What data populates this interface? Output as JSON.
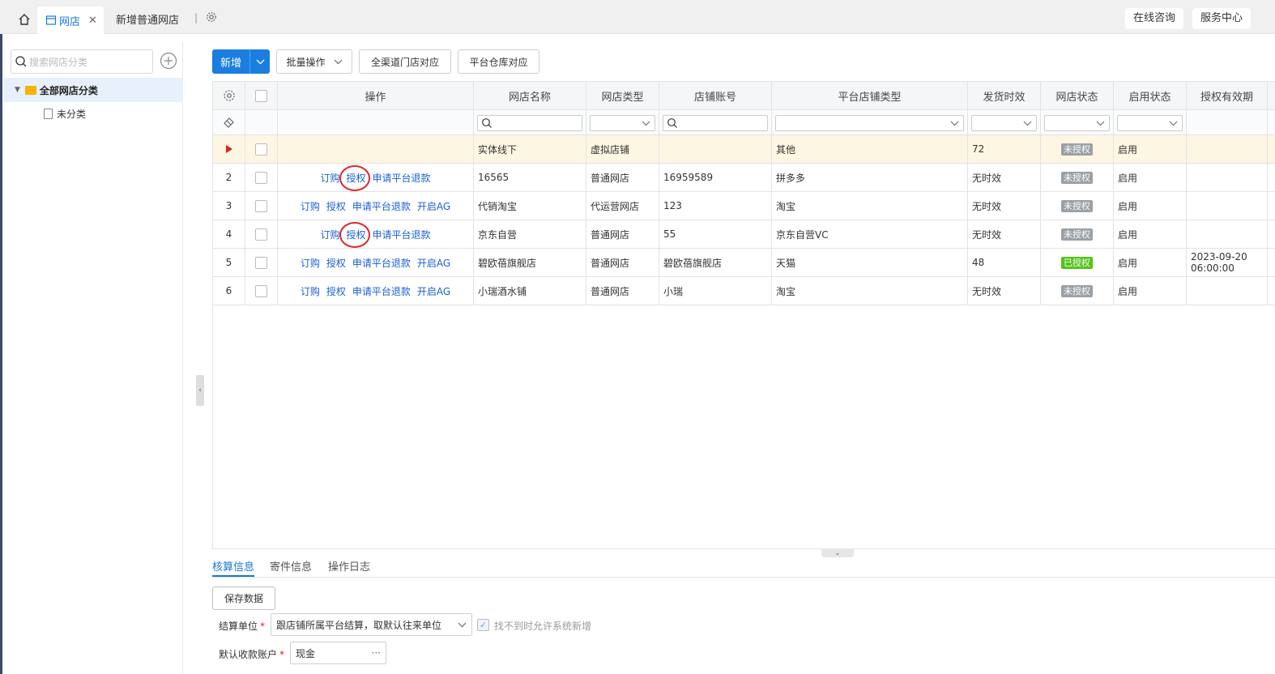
{
  "tabs": {
    "active": "网店",
    "second": "新增普通网店",
    "separator": "|"
  },
  "topbar": {
    "online_consult": "在线咨询",
    "service_center": "服务中心"
  },
  "sidebar": {
    "search_placeholder": "搜索网店分类",
    "root_label": "全部网店分类",
    "child_label": "未分类"
  },
  "toolbar": {
    "new_label": "新增",
    "batch_label": "批量操作",
    "channel_label": "全渠道门店对应",
    "warehouse_label": "平台仓库对应"
  },
  "grid": {
    "columns": [
      "操作",
      "网店名称",
      "网店类型",
      "店铺账号",
      "平台店铺类型",
      "发货时效",
      "网店状态",
      "启用状态",
      "授权有效期"
    ],
    "rows": [
      {
        "num": "",
        "selected": true,
        "ops": [],
        "name": "实体线下",
        "type": "虚拟店铺",
        "account": "",
        "platform": "其他",
        "ship": "72",
        "status": "未授权",
        "status_kind": "no",
        "enabled": "启用",
        "expire": ""
      },
      {
        "num": "2",
        "selected": false,
        "ops": [
          "订购",
          "授权",
          "申请平台退款"
        ],
        "name": "16565",
        "type": "普通网店",
        "account": "16959589",
        "platform": "拼多多",
        "ship": "无时效",
        "status": "未授权",
        "status_kind": "no",
        "enabled": "启用",
        "expire": ""
      },
      {
        "num": "3",
        "selected": false,
        "ops": [
          "订购",
          "授权",
          "申请平台退款",
          "开启AG"
        ],
        "name": "代销淘宝",
        "type": "代运营网店",
        "account": "123",
        "platform": "淘宝",
        "ship": "无时效",
        "status": "未授权",
        "status_kind": "no",
        "enabled": "启用",
        "expire": ""
      },
      {
        "num": "4",
        "selected": false,
        "ops": [
          "订购",
          "授权",
          "申请平台退款"
        ],
        "name": "京东自营",
        "type": "普通网店",
        "account": "55",
        "platform": "京东自营VC",
        "ship": "无时效",
        "status": "未授权",
        "status_kind": "no",
        "enabled": "启用",
        "expire": ""
      },
      {
        "num": "5",
        "selected": false,
        "ops": [
          "订购",
          "授权",
          "申请平台退款",
          "开启AG"
        ],
        "name": "碧欧蓓旗舰店",
        "type": "普通网店",
        "account": "碧欧蓓旗舰店",
        "platform": "天猫",
        "ship": "48",
        "status": "已授权",
        "status_kind": "yes",
        "enabled": "启用",
        "expire": "2023-09-20 06:00:00"
      },
      {
        "num": "6",
        "selected": false,
        "ops": [
          "订购",
          "授权",
          "申请平台退款",
          "开启AG"
        ],
        "name": "小瑞酒水铺",
        "type": "普通网店",
        "account": "小瑞",
        "platform": "淘宝",
        "ship": "无时效",
        "status": "未授权",
        "status_kind": "no",
        "enabled": "启用",
        "expire": ""
      }
    ]
  },
  "bottom": {
    "tabs": [
      "核算信息",
      "寄件信息",
      "操作日志"
    ],
    "save_label": "保存数据",
    "settle_label": "结算单位",
    "settle_value": "跟店铺所属平台结算，取默认往来单位",
    "allow_label": "找不到时允许系统新增",
    "account_label": "默认收款账户",
    "account_value": "现金",
    "more": "···"
  },
  "colors": {
    "accent": "#1a7ee0",
    "link": "#1b5fd1",
    "unauth_badge": "#9aa0a6",
    "auth_badge": "#52c41a",
    "circle_mark": "#e0262b"
  }
}
